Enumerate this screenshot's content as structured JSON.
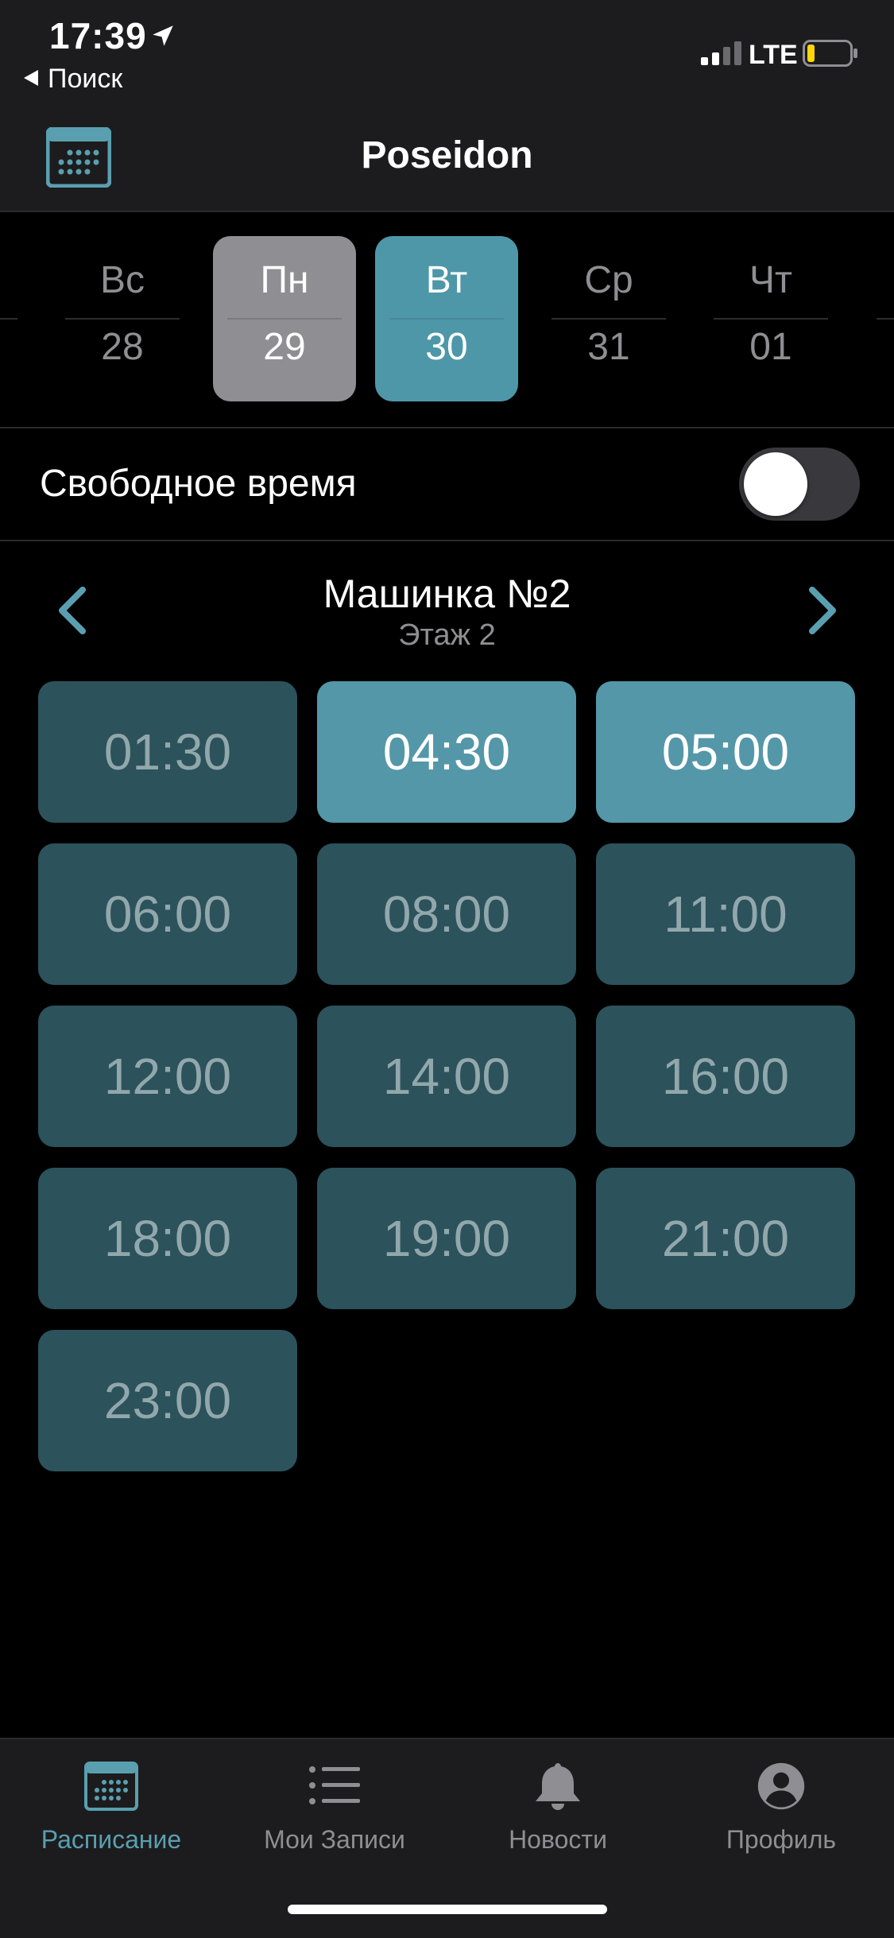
{
  "status_bar": {
    "time": "17:39",
    "network": "LTE",
    "back_label": "Поиск"
  },
  "header": {
    "title": "Poseidon",
    "calendar_icon": "calendar-icon"
  },
  "days": [
    {
      "name": "Вс",
      "date": "28",
      "state": "normal"
    },
    {
      "name": "Пн",
      "date": "29",
      "state": "today"
    },
    {
      "name": "Вт",
      "date": "30",
      "state": "selected"
    },
    {
      "name": "Ср",
      "date": "31",
      "state": "normal"
    },
    {
      "name": "Чт",
      "date": "01",
      "state": "normal"
    }
  ],
  "free_time": {
    "label": "Свободное время",
    "enabled": false
  },
  "machine": {
    "title": "Машинка №2",
    "floor": "Этаж 2"
  },
  "slots": [
    {
      "time": "01:30",
      "selected": false
    },
    {
      "time": "04:30",
      "selected": true
    },
    {
      "time": "05:00",
      "selected": true
    },
    {
      "time": "06:00",
      "selected": false
    },
    {
      "time": "08:00",
      "selected": false
    },
    {
      "time": "11:00",
      "selected": false
    },
    {
      "time": "12:00",
      "selected": false
    },
    {
      "time": "14:00",
      "selected": false
    },
    {
      "time": "16:00",
      "selected": false
    },
    {
      "time": "18:00",
      "selected": false
    },
    {
      "time": "19:00",
      "selected": false
    },
    {
      "time": "21:00",
      "selected": false
    },
    {
      "time": "23:00",
      "selected": false
    }
  ],
  "tabs": [
    {
      "label": "Расписание",
      "icon": "calendar-icon",
      "active": true
    },
    {
      "label": "Мои Записи",
      "icon": "list-icon",
      "active": false
    },
    {
      "label": "Новости",
      "icon": "bell-icon",
      "active": false
    },
    {
      "label": "Профиль",
      "icon": "profile-icon",
      "active": false
    }
  ],
  "colors": {
    "accent": "#5497a8",
    "slot_idle": "#2c525b",
    "today": "#8e8e93"
  }
}
